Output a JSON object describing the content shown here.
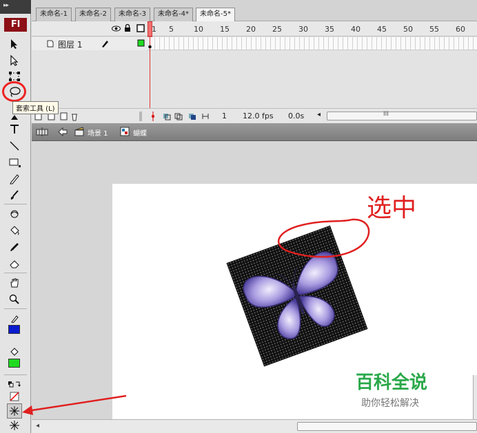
{
  "toolbox": {
    "grip_glyph": "▸▸",
    "logo_text": "Fl",
    "lasso_tooltip": "套索工具 (L)",
    "stroke_color": "#0a1ccf",
    "fill_color": "#1ed91e",
    "icons": [
      "selection-arrow-icon",
      "subselection-arrow-icon",
      "free-transform-icon",
      "lasso-icon",
      "pen-icon",
      "text-icon",
      "line-icon",
      "rectangle-icon",
      "pencil-icon",
      "brush-icon",
      "deco-icon",
      "paint-bucket-icon",
      "eyedropper-icon",
      "eraser-icon",
      "hand-icon",
      "zoom-icon"
    ]
  },
  "tabs": [
    {
      "label": "未命名-1"
    },
    {
      "label": "未命名-2"
    },
    {
      "label": "未命名-3"
    },
    {
      "label": "未命名-4*"
    },
    {
      "label": "未命名-5*"
    }
  ],
  "timeline": {
    "ruler": [
      "1",
      "5",
      "10",
      "15",
      "20",
      "25",
      "30",
      "35",
      "40",
      "45",
      "50",
      "55",
      "60"
    ],
    "layer_name": "图层 1",
    "current_frame": "1",
    "fps": "12.0 fps",
    "elapsed": "0.0s",
    "scroll_thumb": "III"
  },
  "editbar": {
    "scene": "场景 1",
    "symbol": "蝴蝶"
  },
  "stage": {
    "annotation": "选中",
    "annotation_color": "#e02020",
    "watermark_main": "百科全说",
    "watermark_sub": "助你轻松解决"
  }
}
